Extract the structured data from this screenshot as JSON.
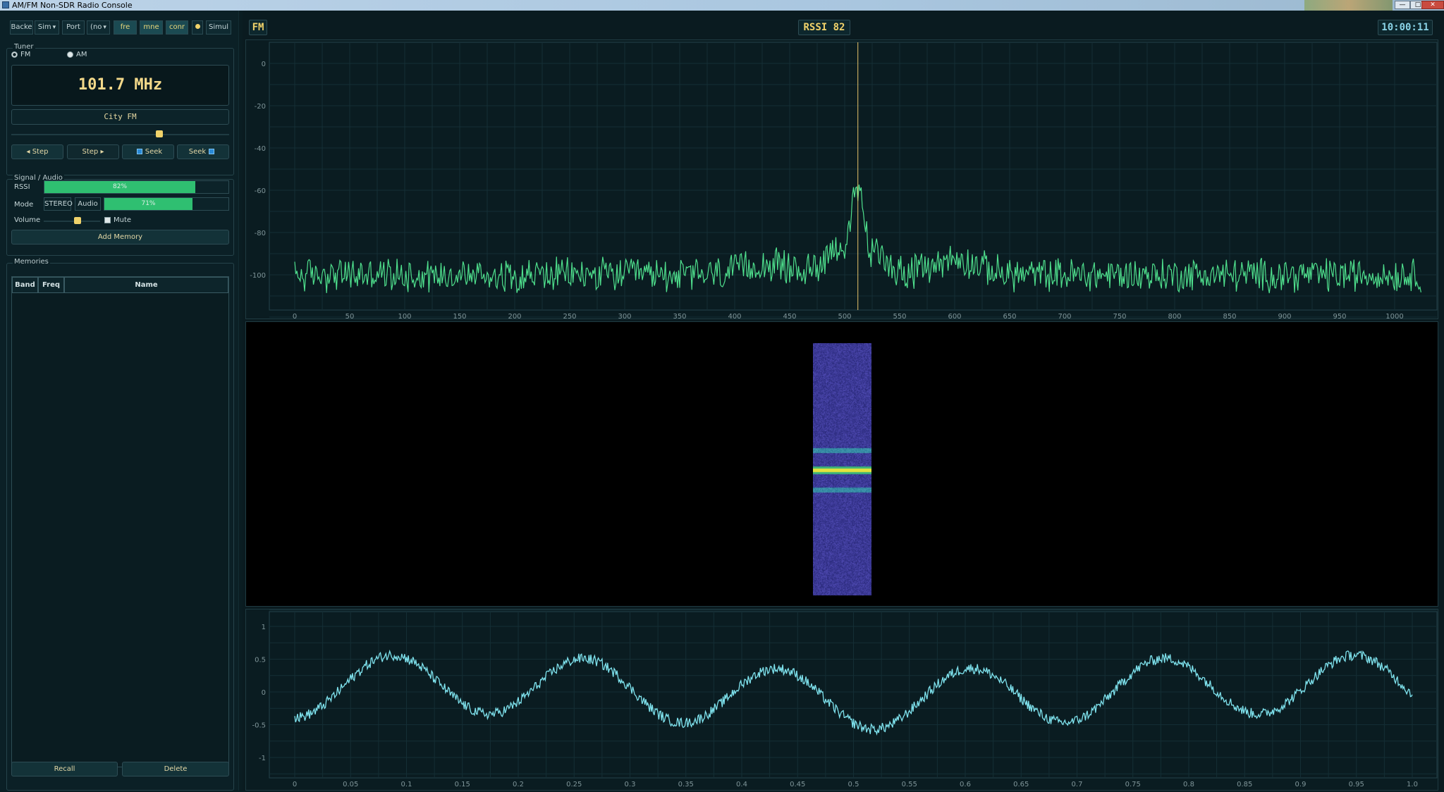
{
  "window": {
    "title": "AM/FM Non-SDR Radio Console",
    "controls": [
      "—",
      "□",
      "✕"
    ]
  },
  "toolbar": {
    "backend_label": "Backe",
    "backend_value": "Sim",
    "port_label": "Port",
    "port_value": "(no",
    "btn_freq": "fre",
    "btn_mne": "mne",
    "btn_conn": "conr",
    "status_dot_color": "#f0d26a",
    "simul_label": "Simul"
  },
  "tuner": {
    "group_label": "Tuner",
    "band_fm": "FM",
    "band_am": "AM",
    "selected_band": "FM",
    "frequency_display": "101.7 MHz",
    "station_name": "City FM",
    "tune_position": 0.68,
    "btn_step_down": "◂ Step",
    "btn_step_up": "Step ▸",
    "btn_seek_down": "Seek",
    "btn_seek_up": "Seek"
  },
  "signal": {
    "group_label": "Signal / Audio",
    "rssi_label": "RSSI",
    "rssi_percent": 82,
    "rssi_text": "82%",
    "mode_label": "Mode",
    "mode_value": "STEREO",
    "audio_label": "Audio",
    "audio_percent": 71,
    "audio_text": "71%",
    "volume_label": "Volume",
    "volume_level": 0.6,
    "mute_label": "Mute",
    "add_memory_label": "Add Memory"
  },
  "memories": {
    "group_label": "Memories",
    "columns": [
      "Band",
      "Freq",
      "Name"
    ],
    "rows": [],
    "recall_label": "Recall",
    "delete_label": "Delete"
  },
  "header": {
    "band": "FM",
    "rssi": "RSSI 82",
    "clock": "10:00:11"
  },
  "spectrum": {
    "x_ticks": [
      "0",
      "50",
      "100",
      "150",
      "200",
      "250",
      "300",
      "350",
      "400",
      "450",
      "500",
      "550",
      "600",
      "650",
      "700",
      "750",
      "800",
      "850",
      "900",
      "950",
      "1000"
    ],
    "y_ticks": [
      "0",
      "-20",
      "-40",
      "-60",
      "-80",
      "-100"
    ],
    "cursor_bin": 512,
    "line_color": "#4fe08d",
    "cursor_color": "#e8c46a"
  },
  "audio_scope": {
    "x_ticks": [
      "0",
      "0.05",
      "0.1",
      "0.15",
      "0.2",
      "0.25",
      "0.3",
      "0.35",
      "0.4",
      "0.45",
      "0.5",
      "0.55",
      "0.6",
      "0.65",
      "0.7",
      "0.75",
      "0.8",
      "0.85",
      "0.9",
      "0.95",
      "1.0"
    ],
    "y_ticks": [
      "1",
      "0.5",
      "0",
      "-0.5",
      "-1"
    ],
    "line_color": "#7fe3ee"
  }
}
